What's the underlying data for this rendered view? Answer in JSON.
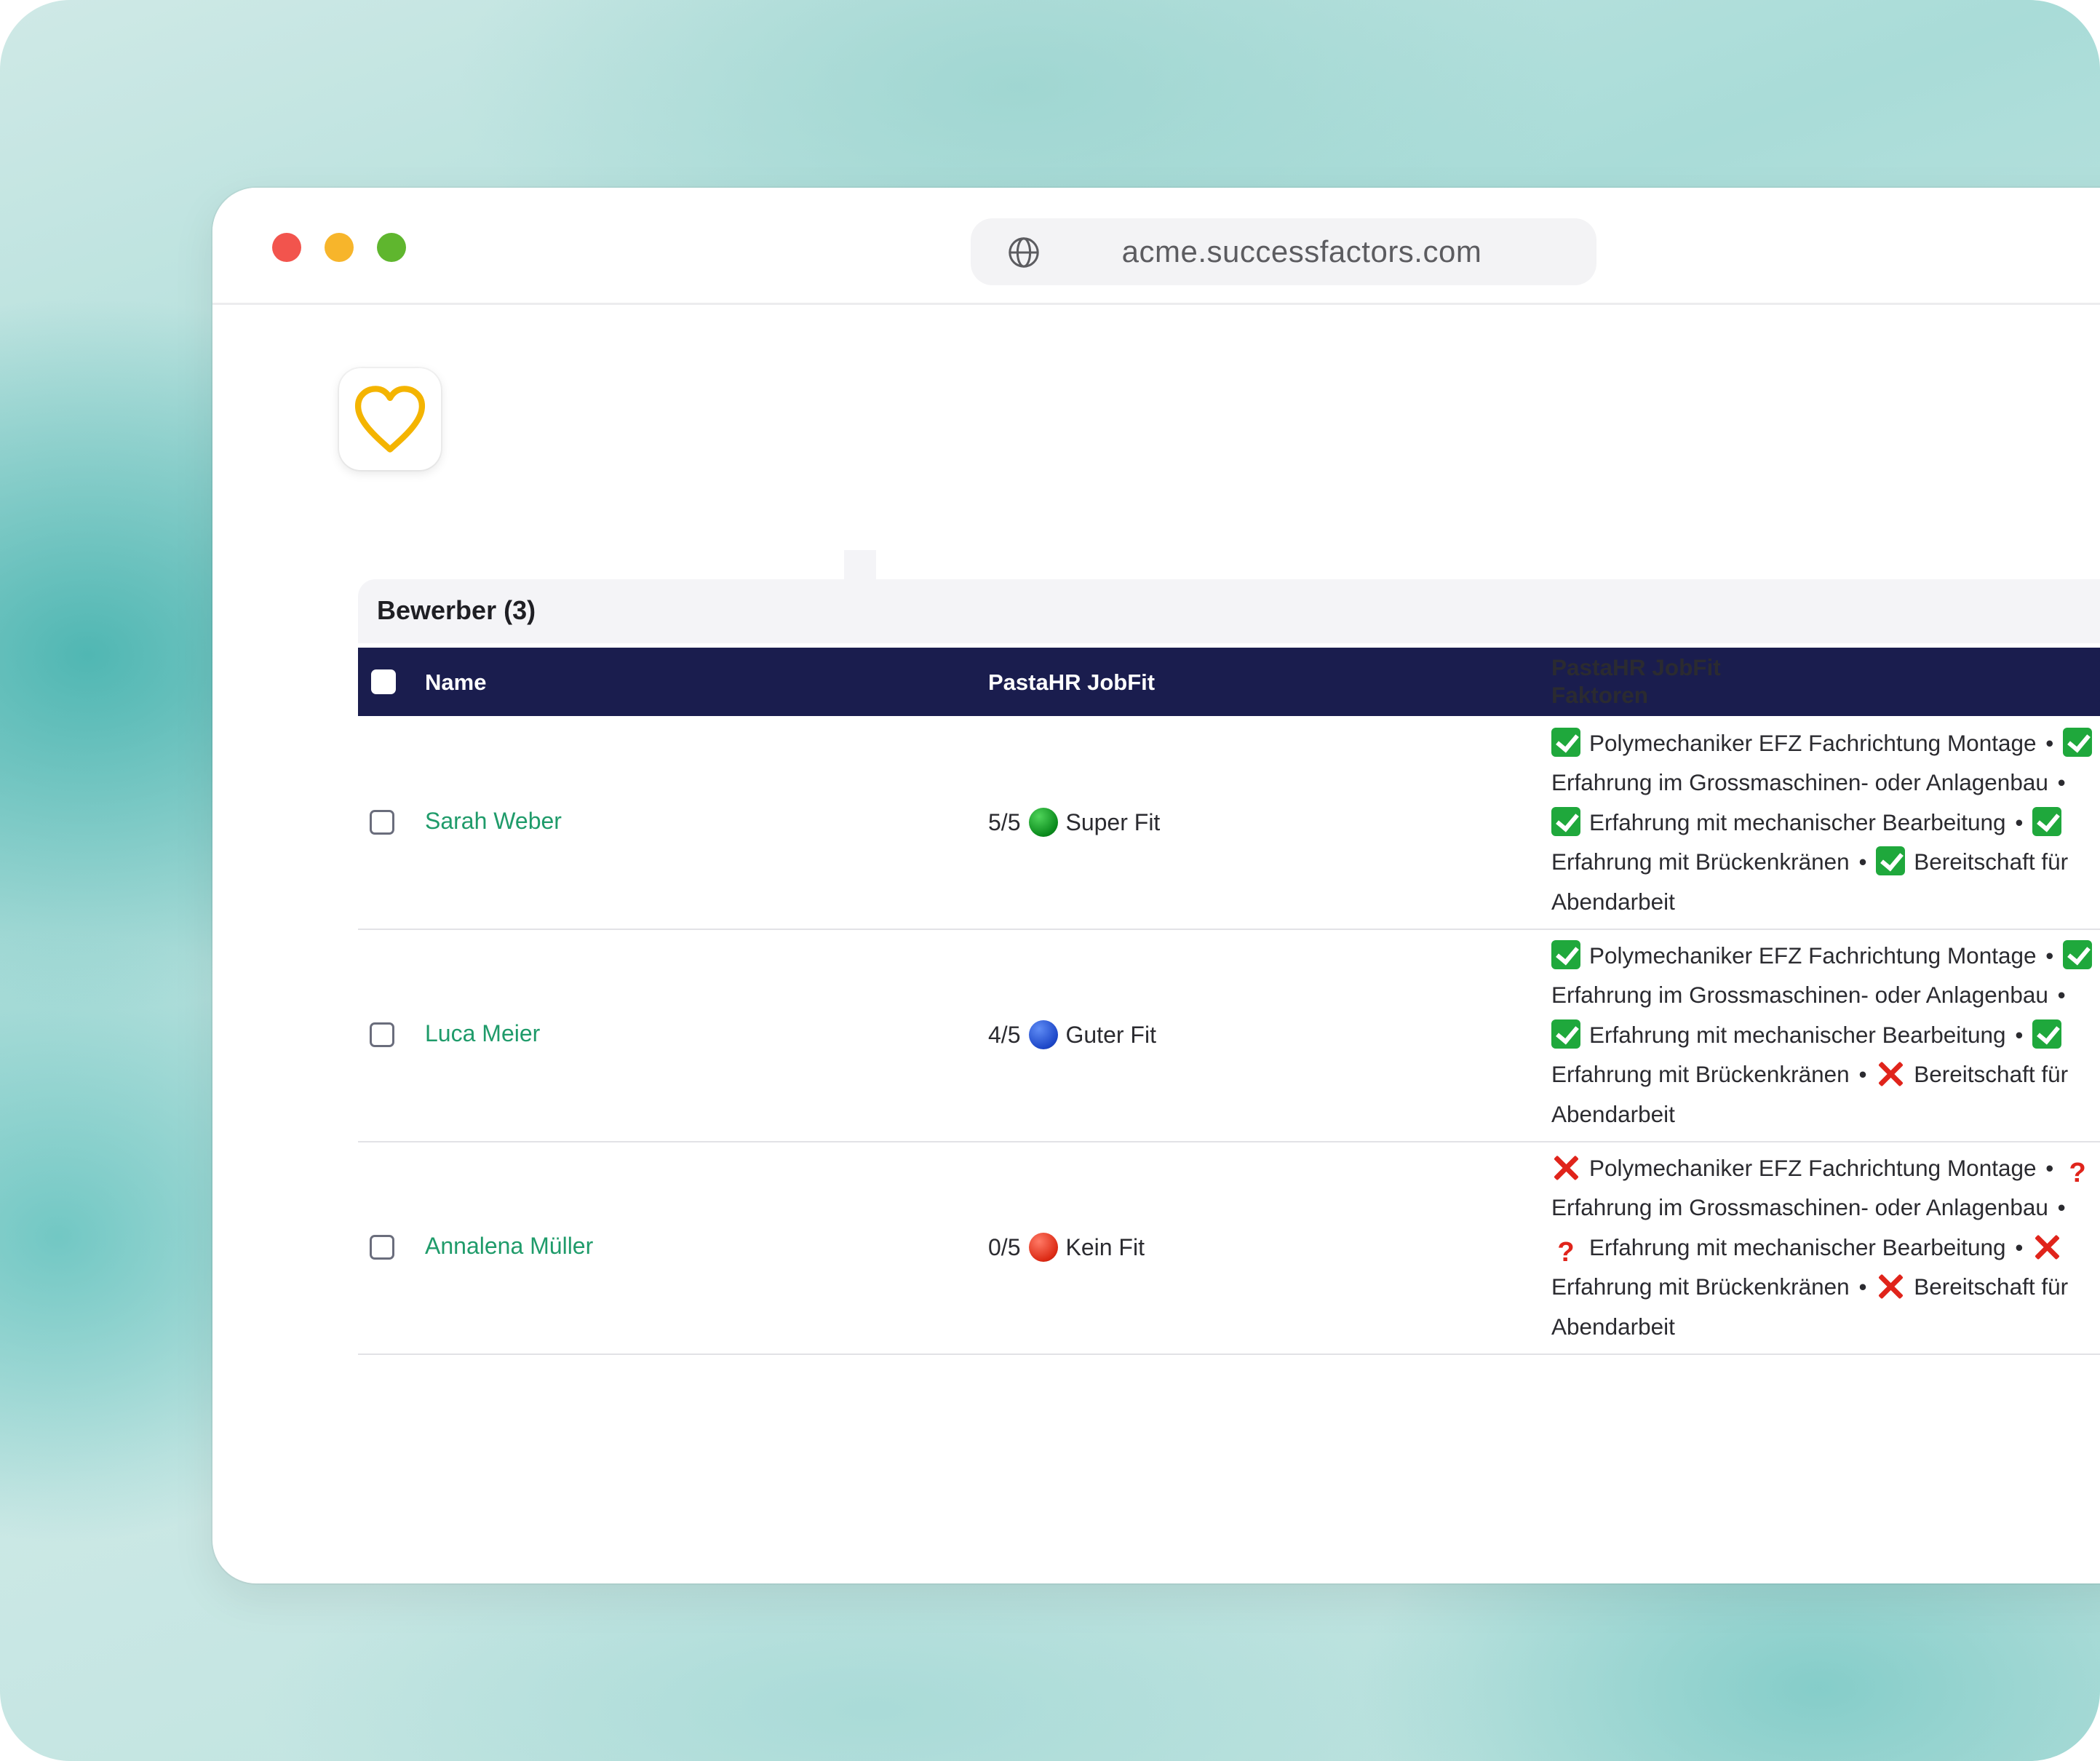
{
  "browser": {
    "url": "acme.successfactors.com"
  },
  "panel": {
    "title": "Bewerber (3)",
    "columns": {
      "name": "Name",
      "jobfit": "PastaHR JobFit",
      "factors_line1": "PastaHR JobFit",
      "factors_line2": "Faktoren"
    }
  },
  "candidates": [
    {
      "name": "Sarah Weber",
      "score": "5/5",
      "fit_label": "Super Fit",
      "fit_color": "green",
      "factors": [
        {
          "status": "ok",
          "text": "Polymechaniker EFZ Fachrichtung Montage"
        },
        {
          "status": "ok",
          "text": "Erfahrung im Grossmaschinen- oder Anlagenbau"
        },
        {
          "status": "ok",
          "text": "Erfahrung mit mechanischer Bearbeitung"
        },
        {
          "status": "ok",
          "text": "Erfahrung mit Brückenkränen"
        },
        {
          "status": "ok",
          "text": "Bereitschaft für Abendarbeit"
        }
      ]
    },
    {
      "name": "Luca Meier",
      "score": "4/5",
      "fit_label": "Guter Fit",
      "fit_color": "blue",
      "factors": [
        {
          "status": "ok",
          "text": "Polymechaniker EFZ Fachrichtung Montage"
        },
        {
          "status": "ok",
          "text": "Erfahrung im Grossmaschinen- oder Anlagenbau"
        },
        {
          "status": "ok",
          "text": "Erfahrung mit mechanischer Bearbeitung"
        },
        {
          "status": "ok",
          "text": "Erfahrung mit Brückenkränen"
        },
        {
          "status": "no",
          "text": "Bereitschaft für Abendarbeit"
        }
      ]
    },
    {
      "name": "Annalena Müller",
      "score": "0/5",
      "fit_label": "Kein Fit",
      "fit_color": "red",
      "factors": [
        {
          "status": "no",
          "text": "Polymechaniker EFZ Fachrichtung Montage"
        },
        {
          "status": "q",
          "text": "Erfahrung im Grossmaschinen- oder Anlagenbau"
        },
        {
          "status": "q",
          "text": "Erfahrung mit mechanischer Bearbeitung"
        },
        {
          "status": "no",
          "text": "Erfahrung mit Brückenkränen"
        },
        {
          "status": "no",
          "text": "Bereitschaft für Abendarbeit"
        }
      ]
    }
  ],
  "factor_separator": "•",
  "icons": {
    "app": "heart-icon",
    "url": "globe-icon",
    "ok": "check-mark-icon",
    "no": "cross-mark-icon",
    "q": "question-mark-icon"
  },
  "colors": {
    "header_bg": "#1a1d4e",
    "name_link": "#1f9b6a",
    "heart": "#f4b400",
    "check": "#1fa83c",
    "cross": "#e0241b"
  }
}
